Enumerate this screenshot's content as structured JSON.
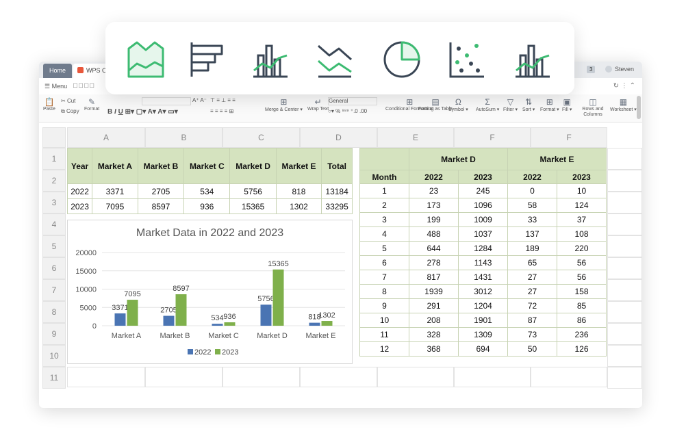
{
  "window": {
    "tabs": [
      {
        "label": "Home"
      },
      {
        "label": "WPS O"
      }
    ],
    "badge": "3",
    "user": "Steven",
    "menu_label": "Menu"
  },
  "ribbon": {
    "paste": "Paste",
    "cut": "Cut",
    "copy": "Copy",
    "format_painter": "Format",
    "merge_center": "Merge & Center",
    "wrap_text": "Wrap Text",
    "number_format": "General",
    "conditional_formatting": "Conditional Formatting",
    "format_as_table": "Format as Table",
    "symbol": "Symbol",
    "autosum": "AutoSum",
    "filter": "Filter",
    "sort": "Sort",
    "format": "Format",
    "fill": "Fill",
    "rows_columns": "Rows and Columns",
    "worksheet": "Worksheet"
  },
  "columns": [
    "A",
    "B",
    "C",
    "D",
    "E",
    "F",
    "F"
  ],
  "rows": [
    "1",
    "2",
    "3",
    "4",
    "5",
    "6",
    "7",
    "8",
    "9",
    "10",
    "11"
  ],
  "table_left": {
    "headers": [
      "Year",
      "Market A",
      "Market B",
      "Market C",
      "Market D",
      "Market E",
      "Total"
    ],
    "rows": [
      [
        "2022",
        "3371",
        "2705",
        "534",
        "5756",
        "818",
        "13184"
      ],
      [
        "2023",
        "7095",
        "8597",
        "936",
        "15365",
        "1302",
        "33295"
      ]
    ]
  },
  "table_right": {
    "group_headers": [
      "Market D",
      "Market E"
    ],
    "sub_headers": [
      "Month",
      "2022",
      "2023",
      "2022",
      "2023"
    ],
    "rows": [
      [
        "1",
        "23",
        "245",
        "0",
        "10"
      ],
      [
        "2",
        "173",
        "1096",
        "58",
        "124"
      ],
      [
        "3",
        "199",
        "1009",
        "33",
        "37"
      ],
      [
        "4",
        "488",
        "1037",
        "137",
        "108"
      ],
      [
        "5",
        "644",
        "1284",
        "189",
        "220"
      ],
      [
        "6",
        "278",
        "1143",
        "65",
        "56"
      ],
      [
        "7",
        "817",
        "1431",
        "27",
        "56"
      ],
      [
        "8",
        "1939",
        "3012",
        "27",
        "158"
      ],
      [
        "9",
        "291",
        "1204",
        "72",
        "85"
      ],
      [
        "10",
        "208",
        "1901",
        "87",
        "86"
      ],
      [
        "11",
        "328",
        "1309",
        "73",
        "236"
      ],
      [
        "12",
        "368",
        "694",
        "50",
        "126"
      ]
    ]
  },
  "chart_data": {
    "type": "bar",
    "title": "Market Data in 2022 and 2023",
    "categories": [
      "Market A",
      "Market B",
      "Market C",
      "Market D",
      "Market E"
    ],
    "series": [
      {
        "name": "2022",
        "values": [
          3371,
          2705,
          534,
          5756,
          818
        ],
        "color": "#4a74b3"
      },
      {
        "name": "2023",
        "values": [
          7095,
          8597,
          936,
          15365,
          1302
        ],
        "color": "#7fb04b"
      }
    ],
    "yticks": [
      "0",
      "5000",
      "10000",
      "15000",
      "20000"
    ],
    "ylim": [
      0,
      20000
    ],
    "legend": "bottom",
    "grid": true
  },
  "toolbar": {
    "icons": [
      "area-chart-icon",
      "horizontal-bar-chart-icon",
      "bar-line-chart-icon",
      "line-chart-icon",
      "pie-chart-icon",
      "scatter-chart-icon",
      "combo-chart-icon"
    ],
    "active": "area-chart-icon",
    "accent": "#3dbb72",
    "stroke": "#3a4655"
  }
}
